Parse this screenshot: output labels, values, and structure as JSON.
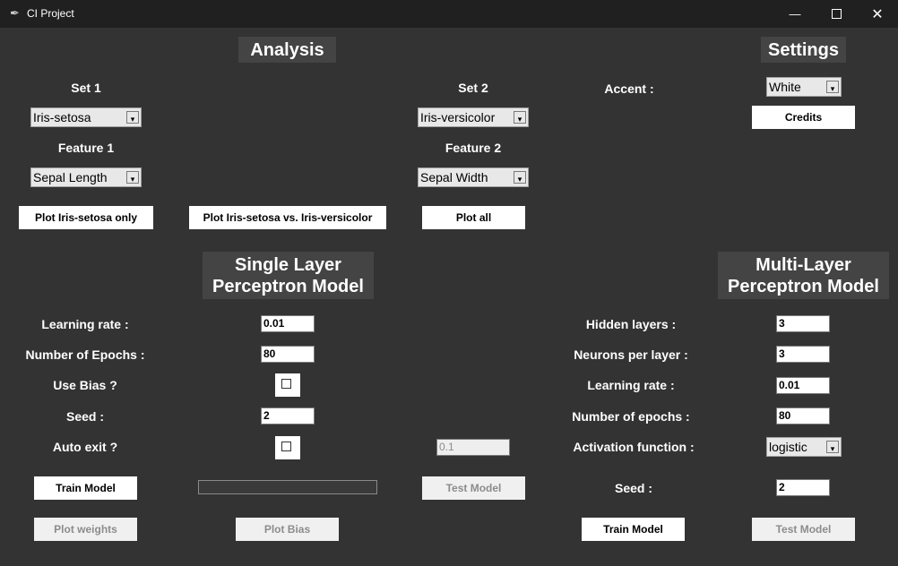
{
  "window": {
    "title": "CI Project",
    "icons": {
      "app": "feather-icon",
      "minimize": "minimize-icon",
      "maximize": "maximize-icon",
      "close": "close-icon"
    }
  },
  "colors": {
    "background": "#333333",
    "heading_bg": "#444444",
    "titlebar": "#202020",
    "text": "#ffffff"
  },
  "analysis": {
    "heading": "Analysis",
    "set1_label": "Set 1",
    "set1_value": "Iris-setosa",
    "feature1_label": "Feature 1",
    "feature1_value": "Sepal Length",
    "set2_label": "Set 2",
    "set2_value": "Iris-versicolor",
    "feature2_label": "Feature 2",
    "feature2_value": "Sepal Width",
    "plot_set1_button": "Plot Iris-setosa only",
    "plot_vs_button": "Plot Iris-setosa vs. Iris-versicolor",
    "plot_all_button": "Plot all"
  },
  "settings": {
    "heading": "Settings",
    "accent_label": "Accent :",
    "accent_value": "White",
    "credits_button": "Credits"
  },
  "slp": {
    "heading_line1": "Single Layer",
    "heading_line2": "Perceptron Model",
    "learning_rate_label": "Learning rate :",
    "learning_rate_value": "0.01",
    "epochs_label": "Number of Epochs :",
    "epochs_value": "80",
    "use_bias_label": "Use Bias ?",
    "use_bias_checked": false,
    "seed_label": "Seed :",
    "seed_value": "2",
    "auto_exit_label": "Auto exit ?",
    "auto_exit_checked": false,
    "auto_exit_value": "0.1",
    "train_button": "Train Model",
    "progress": 0,
    "test_button": "Test Model",
    "plot_weights_button": "Plot weights",
    "plot_bias_button": "Plot Bias"
  },
  "mlp": {
    "heading_line1": "Multi-Layer",
    "heading_line2": "Perceptron Model",
    "hidden_layers_label": "Hidden layers :",
    "hidden_layers_value": "3",
    "neurons_label": "Neurons per layer :",
    "neurons_value": "3",
    "learning_rate_label": "Learning rate :",
    "learning_rate_value": "0.01",
    "epochs_label": "Number of epochs :",
    "epochs_value": "80",
    "activation_label": "Activation function :",
    "activation_value": "logistic",
    "seed_label": "Seed :",
    "seed_value": "2",
    "train_button": "Train Model",
    "test_button": "Test Model"
  }
}
